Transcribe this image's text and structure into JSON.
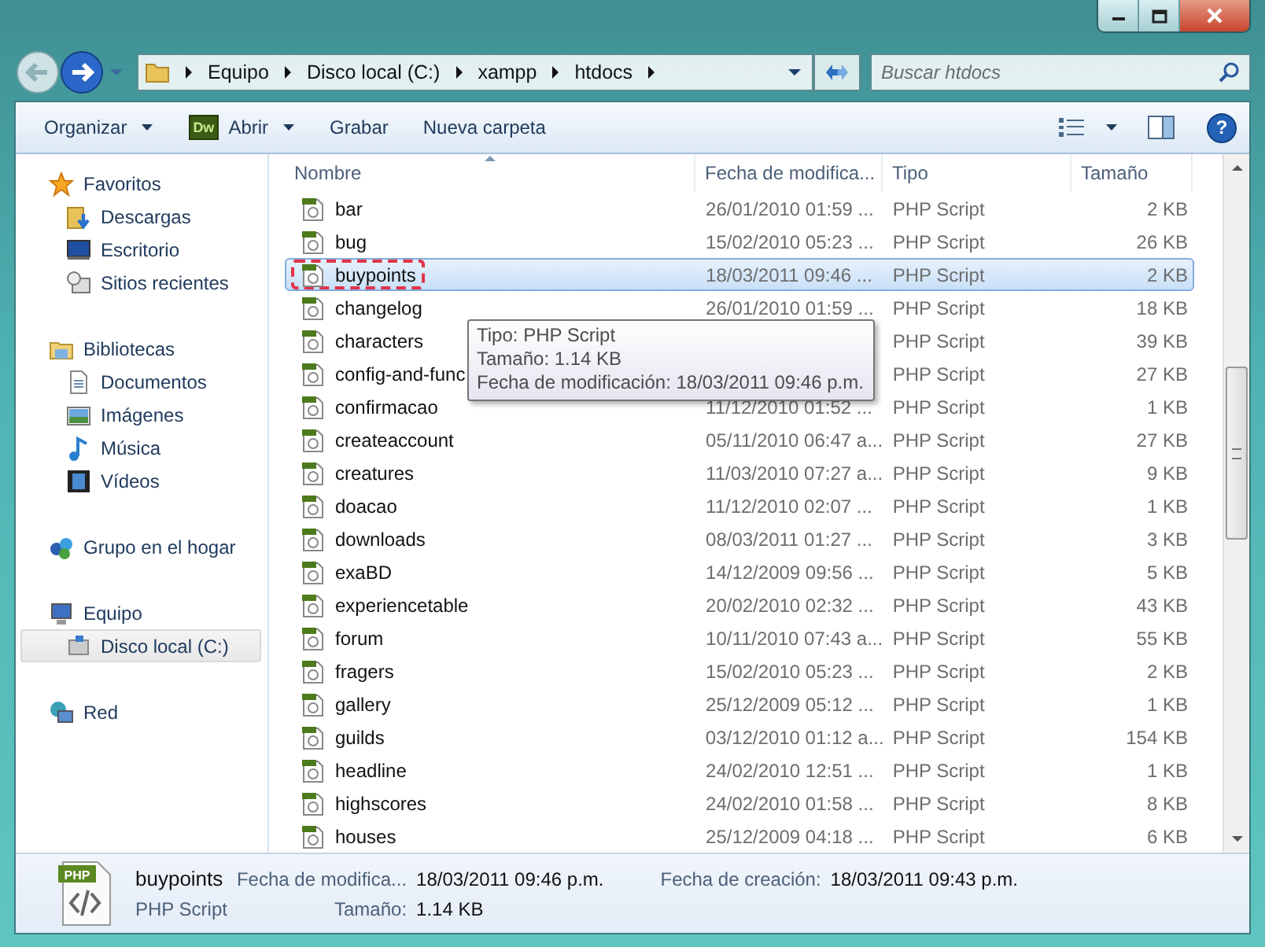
{
  "address": {
    "crumbs": [
      "Equipo",
      "Disco local (C:)",
      "xampp",
      "htdocs"
    ]
  },
  "search": {
    "placeholder": "Buscar htdocs"
  },
  "toolbar": {
    "buttons": [
      {
        "label": "Organizar",
        "menu": true
      },
      {
        "label": "Abrir",
        "badge": "Dw",
        "menu": true
      },
      {
        "label": "Grabar",
        "menu": false
      },
      {
        "label": "Nueva carpeta",
        "menu": false
      }
    ],
    "help": "?"
  },
  "sidebar": {
    "groups": [
      {
        "label": "Favoritos",
        "selected": false,
        "children": [
          {
            "label": "Descargas",
            "selected": false
          },
          {
            "label": "Escritorio",
            "selected": false
          },
          {
            "label": "Sitios recientes",
            "selected": false
          }
        ]
      },
      {
        "label": "Bibliotecas",
        "selected": false,
        "children": [
          {
            "label": "Documentos",
            "selected": false
          },
          {
            "label": "Imágenes",
            "selected": false
          },
          {
            "label": "Música",
            "selected": false
          },
          {
            "label": "Vídeos",
            "selected": false
          }
        ]
      },
      {
        "label": "Grupo en el hogar",
        "selected": false
      },
      {
        "label": "Equipo",
        "selected": false,
        "children": [
          {
            "label": "Disco local (C:)",
            "selected": true
          }
        ]
      },
      {
        "label": "Red",
        "selected": false
      }
    ]
  },
  "table": {
    "columns": [
      {
        "label": "Nombre",
        "sorted": true
      },
      {
        "label": "Fecha de modifica...",
        "sorted": false
      },
      {
        "label": "Tipo",
        "sorted": false
      },
      {
        "label": "Tamaño",
        "sorted": false
      }
    ],
    "rows": [
      {
        "name": "bar",
        "date": "26/01/2010 01:59 ...",
        "type": "PHP Script",
        "size": "2 KB",
        "selected": false,
        "circled": false
      },
      {
        "name": "bug",
        "date": "15/02/2010 05:23 ...",
        "type": "PHP Script",
        "size": "26 KB",
        "selected": false,
        "circled": false
      },
      {
        "name": "buypoints",
        "date": "18/03/2011 09:46 ...",
        "type": "PHP Script",
        "size": "2 KB",
        "selected": true,
        "circled": true
      },
      {
        "name": "changelog",
        "date": "26/01/2010 01:59 ...",
        "type": "PHP Script",
        "size": "18 KB",
        "selected": false,
        "circled": false
      },
      {
        "name": "characters",
        "type": "PHP Script",
        "size": "39 KB",
        "selected": false,
        "circled": false
      },
      {
        "name": "config-and-func",
        "type": "PHP Script",
        "size": "27 KB",
        "selected": false,
        "circled": false
      },
      {
        "name": "confirmacao",
        "date": "11/12/2010 01:52 ...",
        "type": "PHP Script",
        "size": "1 KB",
        "selected": false,
        "circled": false
      },
      {
        "name": "createaccount",
        "date": "05/11/2010 06:47 a...",
        "type": "PHP Script",
        "size": "27 KB",
        "selected": false,
        "circled": false
      },
      {
        "name": "creatures",
        "date": "11/03/2010 07:27 a...",
        "type": "PHP Script",
        "size": "9 KB",
        "selected": false,
        "circled": false
      },
      {
        "name": "doacao",
        "date": "11/12/2010 02:07 ...",
        "type": "PHP Script",
        "size": "1 KB",
        "selected": false,
        "circled": false
      },
      {
        "name": "downloads",
        "date": "08/03/2011 01:27 ...",
        "type": "PHP Script",
        "size": "3 KB",
        "selected": false,
        "circled": false
      },
      {
        "name": "exaBD",
        "date": "14/12/2009 09:56 ...",
        "type": "PHP Script",
        "size": "5 KB",
        "selected": false,
        "circled": false
      },
      {
        "name": "experiencetable",
        "date": "20/02/2010 02:32 ...",
        "type": "PHP Script",
        "size": "43 KB",
        "selected": false,
        "circled": false
      },
      {
        "name": "forum",
        "date": "10/11/2010 07:43 a...",
        "type": "PHP Script",
        "size": "55 KB",
        "selected": false,
        "circled": false
      },
      {
        "name": "fragers",
        "date": "15/02/2010 05:23 ...",
        "type": "PHP Script",
        "size": "2 KB",
        "selected": false,
        "circled": false
      },
      {
        "name": "gallery",
        "date": "25/12/2009 05:12 ...",
        "type": "PHP Script",
        "size": "1 KB",
        "selected": false,
        "circled": false
      },
      {
        "name": "guilds",
        "date": "03/12/2010 01:12 a...",
        "type": "PHP Script",
        "size": "154 KB",
        "selected": false,
        "circled": false
      },
      {
        "name": "headline",
        "date": "24/02/2010 12:51 ...",
        "type": "PHP Script",
        "size": "1 KB",
        "selected": false,
        "circled": false
      },
      {
        "name": "highscores",
        "date": "24/02/2010 01:58 ...",
        "type": "PHP Script",
        "size": "8 KB",
        "selected": false,
        "circled": false
      },
      {
        "name": "houses",
        "date": "25/12/2009 04:18 ...",
        "type": "PHP Script",
        "size": "6 KB",
        "selected": false,
        "circled": false
      }
    ]
  },
  "tooltip": {
    "lines": [
      "Tipo: PHP Script",
      "Tamaño: 1.14 KB",
      "Fecha de modificación: 18/03/2011 09:46 p.m."
    ]
  },
  "details": {
    "icon_label": "PHP",
    "name": "buypoints",
    "type": "PHP Script",
    "fields": [
      {
        "label": "Fecha de modifica...",
        "value": "18/03/2011 09:46 p.m."
      },
      {
        "label": "Tamaño:",
        "value": "1.14 KB"
      },
      {
        "label": "Fecha de creación:",
        "value": "18/03/2011 09:43 p.m."
      }
    ]
  }
}
